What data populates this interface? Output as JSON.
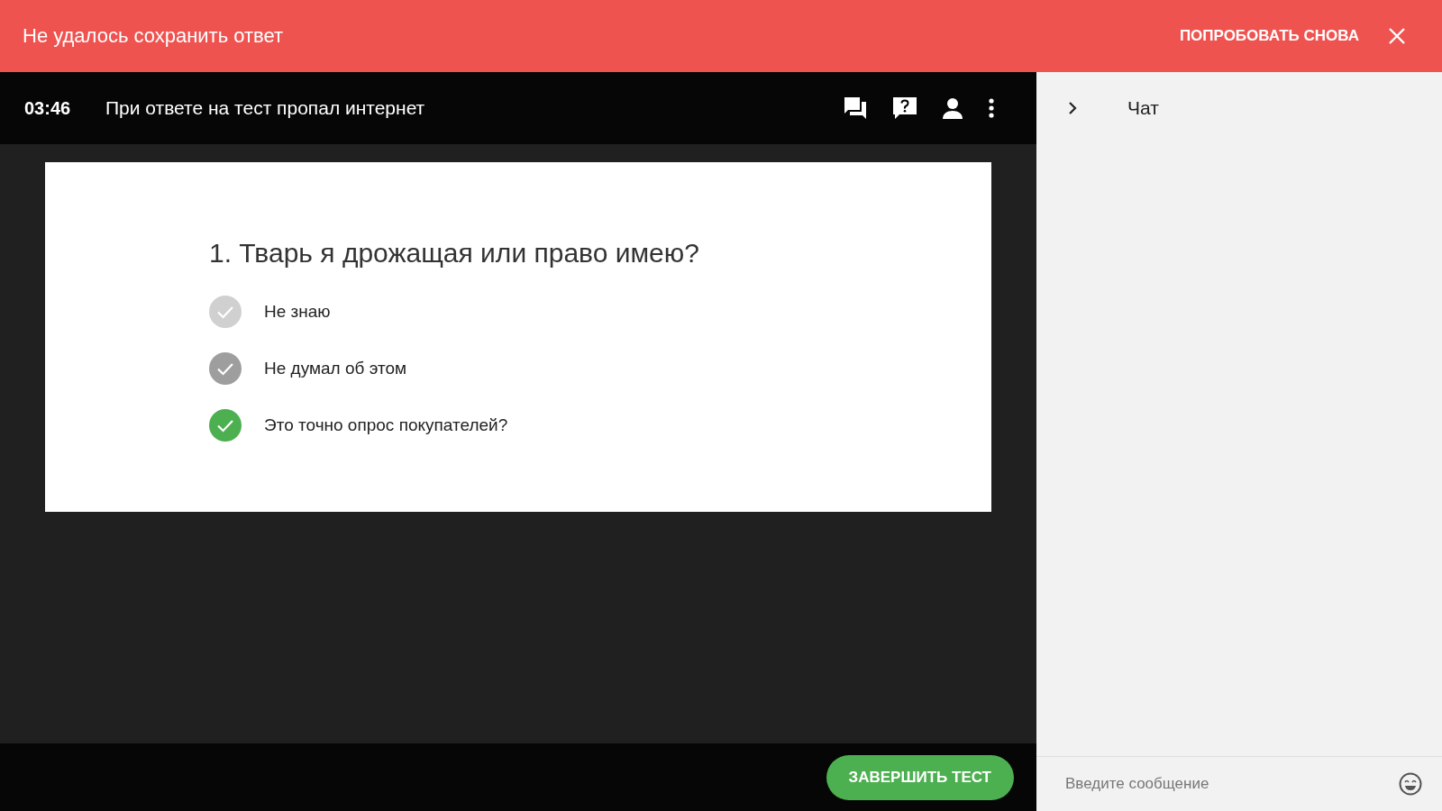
{
  "error_banner": {
    "message": "Не удалось сохранить ответ",
    "retry": "ПОПРОБОВАТЬ СНОВА"
  },
  "header": {
    "timer": "03:46",
    "title": "При ответе на тест пропал интернет"
  },
  "question": {
    "text": "1. Тварь я дрожащая или право имею?",
    "answers": [
      {
        "label": "Не знаю",
        "selected": false,
        "hovered": false
      },
      {
        "label": "Не думал об этом",
        "selected": false,
        "hovered": true
      },
      {
        "label": "Это точно опрос покупателей?",
        "selected": true,
        "hovered": false
      }
    ]
  },
  "finish_button": "ЗАВЕРШИТЬ ТЕСТ",
  "chat": {
    "title": "Чат",
    "input": {
      "placeholder": "Введите сообщение"
    }
  }
}
